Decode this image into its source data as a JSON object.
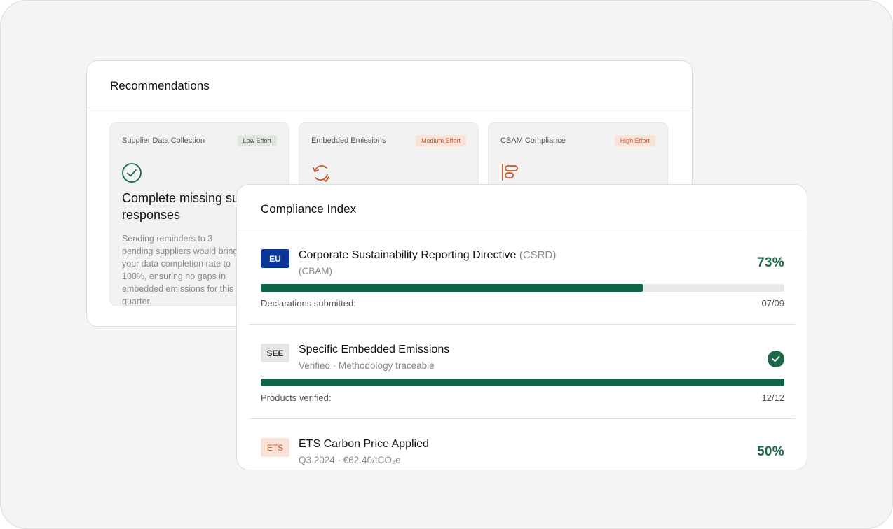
{
  "recommendations": {
    "title": "Recommendations",
    "cards": [
      {
        "category": "Supplier Data Collection",
        "effort": "Low Effort",
        "icon": "check-circle-icon",
        "heading": "Complete missing supplier responses",
        "body": "Sending reminders to 3 pending suppliers would bring your data completion rate to 100%, ensuring no gaps in embedded emissions for this quarter."
      },
      {
        "category": "Embedded Emissions",
        "effort": "Medium Effort",
        "icon": "refresh-icon"
      },
      {
        "category": "CBAM Compliance",
        "effort": "High Effort",
        "icon": "align-left-icon"
      }
    ]
  },
  "compliance_index": {
    "title": "Compliance Index",
    "items": [
      {
        "tag": "EU",
        "title": "Corporate Sustainability Reporting Directive",
        "title_suffix": "(CSRD)",
        "subtitle": "(CBAM)",
        "percent_label": "73%",
        "progress": 0.73,
        "meta_label": "Declarations submitted:",
        "meta_value": "07/09"
      },
      {
        "tag": "SEE",
        "title": "Specific Embedded Emissions",
        "subtitle": "Verified · Methodology traceable",
        "status_icon": "check-circle-filled-icon",
        "progress": 1.0,
        "meta_label": "Products verified:",
        "meta_value": "12/12"
      },
      {
        "tag": "ETS",
        "title": "ETS Carbon Price Applied",
        "subtitle": "Q3 2024 · €62.40/tCO₂e",
        "percent_label": "50%",
        "progress": 0.5
      }
    ]
  },
  "colors": {
    "accent_green": "#1a6a47",
    "eu_blue": "#0b3596",
    "effort_orange": "#c8552b"
  }
}
